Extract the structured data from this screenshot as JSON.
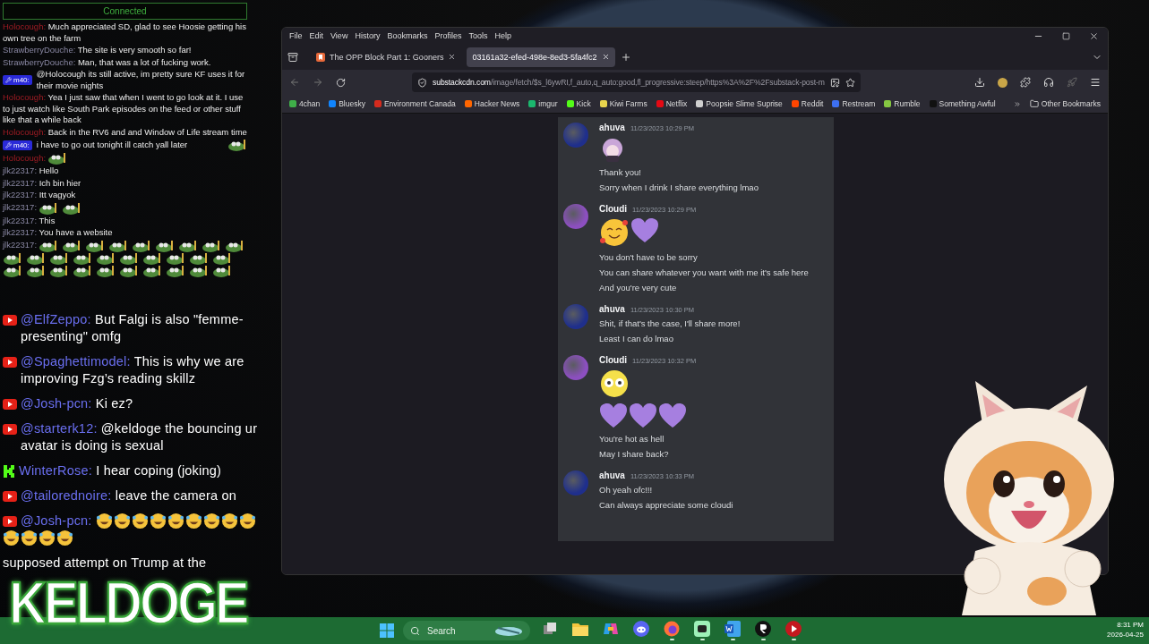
{
  "top_chat": {
    "status": "Connected",
    "messages": [
      {
        "kind": "highlighted",
        "author": "Holocough:",
        "text": "Much appreciated SD, glad to see Hoosie getting his own tree on the farm"
      },
      {
        "kind": "regular",
        "author": "StrawberryDouche:",
        "text": "The site is very smooth so far!"
      },
      {
        "kind": "regular",
        "author": "StrawberryDouche:",
        "text": "Man, that was a lot of fucking work."
      },
      {
        "kind": "moderator",
        "badge": "m40:",
        "text": "@Holocough its still active, im pretty sure KF uses it for their movie nights"
      },
      {
        "kind": "highlighted",
        "author": "Holocough:",
        "text": "Yea I just saw that when I went to go look at it.  I use to just watch like South Park episodes on the feed or other stuff like that a while back"
      },
      {
        "kind": "highlighted",
        "author": "Holocough:",
        "text": "Back in the RV6 and and Window of Life stream time"
      },
      {
        "kind": "moderator",
        "badge": "m40:",
        "text": "i have to go out tonight ill catch yall later",
        "emotes": [
          {
            "kind": "frog"
          }
        ]
      },
      {
        "kind": "highlighted",
        "author": "Holocough:",
        "emotes": [
          {
            "kind": "frog"
          }
        ]
      },
      {
        "kind": "regular",
        "author": "jlk22317:",
        "text": "Hello"
      },
      {
        "kind": "regular",
        "author": "jlk22317:",
        "text": "Ich bin hier"
      },
      {
        "kind": "regular",
        "author": "jlk22317:",
        "text": "Itt vagyok"
      },
      {
        "kind": "regular",
        "author": "jlk22317:",
        "emotes": [
          {
            "kind": "frog"
          },
          {
            "kind": "frog"
          }
        ]
      },
      {
        "kind": "regular",
        "author": "jlk22317:",
        "text": "This"
      },
      {
        "kind": "regular",
        "author": "jlk22317:",
        "text": "You have a website"
      },
      {
        "kind": "regular",
        "author": "jlk22317:",
        "emotes": [
          {
            "kind": "frog"
          },
          {
            "kind": "frog"
          },
          {
            "kind": "frog"
          },
          {
            "kind": "frog"
          },
          {
            "kind": "frog"
          },
          {
            "kind": "frog"
          },
          {
            "kind": "frog"
          },
          {
            "kind": "frog"
          },
          {
            "kind": "frog"
          },
          {
            "kind": "frog"
          },
          {
            "kind": "frog"
          },
          {
            "kind": "frog"
          },
          {
            "kind": "frog"
          },
          {
            "kind": "frog"
          },
          {
            "kind": "frog"
          },
          {
            "kind": "frog"
          },
          {
            "kind": "frog"
          },
          {
            "kind": "frog"
          },
          {
            "kind": "frog"
          },
          {
            "kind": "frog"
          },
          {
            "kind": "frog"
          },
          {
            "kind": "frog"
          },
          {
            "kind": "frog"
          },
          {
            "kind": "frog"
          },
          {
            "kind": "frog"
          },
          {
            "kind": "frog"
          },
          {
            "kind": "frog"
          },
          {
            "kind": "frog"
          },
          {
            "kind": "frog"
          }
        ]
      }
    ]
  },
  "bottom_chat": {
    "messages": [
      {
        "kind": "youtube",
        "author": "@ElfZeppo:",
        "text": "But Falgi is also \"femme-presenting\" omfg"
      },
      {
        "kind": "youtube",
        "author": "@Spaghettimodel:",
        "text": "This is why we are improving Fzg’s reading skillz"
      },
      {
        "kind": "youtube",
        "author": "@Josh-pcn:",
        "text": "Ki ez?"
      },
      {
        "kind": "youtube",
        "author": "@starterk12:",
        "text": "@keldoge the bouncing ur avatar is doing is sexual"
      },
      {
        "kind": "kick",
        "author": "WinterRose:",
        "text": "I hear coping (joking)"
      },
      {
        "kind": "youtube",
        "author": "@tailorednoire:",
        "text": "leave the camera on"
      },
      {
        "kind": "youtube",
        "author": "@Josh-pcn:",
        "emojis": [
          {
            "kind": "rofl"
          },
          {
            "kind": "rofl"
          },
          {
            "kind": "rofl"
          },
          {
            "kind": "rofl"
          },
          {
            "kind": "rofl"
          },
          {
            "kind": "rofl"
          },
          {
            "kind": "rofl"
          },
          {
            "kind": "rofl"
          },
          {
            "kind": "rofl"
          },
          {
            "kind": "rofl"
          },
          {
            "kind": "rofl"
          },
          {
            "kind": "rofl"
          },
          {
            "kind": "rofl"
          }
        ]
      },
      {
        "kind": "plain",
        "text": "supposed attempt on Trump at the"
      }
    ],
    "logo": "KELDOGE"
  },
  "browser": {
    "menu": [
      "File",
      "Edit",
      "View",
      "History",
      "Bookmarks",
      "Profiles",
      "Tools",
      "Help"
    ],
    "tabs": [
      {
        "title": "The OPP Block Part 1: Gooners",
        "selected": false
      },
      {
        "title": "03161a32-efed-498e-8ed3-5fa4fc2",
        "selected": true
      }
    ],
    "address": {
      "domain": "substackcdn.com",
      "path": "/image/fetch/$s_l6ywRI,f_auto,q_auto:good,fl_progressive:steep/https%3A%2F%2Fsubstack-post-m"
    },
    "bookmarks": [
      {
        "label": "4chan",
        "color": "#3fae49"
      },
      {
        "label": "Bluesky",
        "color": "#1185fe"
      },
      {
        "label": "Environment Canada",
        "color": "#d52b1e"
      },
      {
        "label": "Hacker News",
        "color": "#ff6600"
      },
      {
        "label": "imgur",
        "color": "#1bb76e"
      },
      {
        "label": "Kick",
        "color": "#53fc18"
      },
      {
        "label": "Kiwi Farms",
        "color": "#e8d44d"
      },
      {
        "label": "Netflix",
        "color": "#e50914"
      },
      {
        "label": "Poopsie Slime Suprise",
        "color": "#cfcfcf"
      },
      {
        "label": "Reddit",
        "color": "#ff4500"
      },
      {
        "label": "Restream",
        "color": "#3d6ff2"
      },
      {
        "label": "Rumble",
        "color": "#85c742"
      },
      {
        "label": "Something Awful",
        "color": "#111111"
      }
    ],
    "other_bookmarks": "Other Bookmarks",
    "image": {
      "messages": [
        {
          "author": "ahuva",
          "color": "#1f2f8c",
          "time": "11/23/2023 10:29 PM",
          "content": [
            {
              "kind": "emoji",
              "emojis": [
                {
                  "kind": "anime"
                }
              ]
            },
            {
              "kind": "text",
              "text": "Thank you!"
            },
            {
              "kind": "text",
              "text": "Sorry when I drink I share everything lmao"
            }
          ]
        },
        {
          "author": "Cloudi",
          "color": "#8c4fc0",
          "time": "11/23/2023 10:29 PM",
          "content": [
            {
              "kind": "emoji",
              "emojis": [
                {
                  "kind": "blush"
                },
                {
                  "kind": "heart"
                }
              ]
            },
            {
              "kind": "text",
              "text": "You don't have to be sorry"
            },
            {
              "kind": "text",
              "text": "You can share whatever you want with me it's safe here"
            },
            {
              "kind": "text",
              "text": "And you're very cute"
            }
          ]
        },
        {
          "author": "ahuva",
          "color": "#1f2f8c",
          "time": "11/23/2023 10:30 PM",
          "content": [
            {
              "kind": "text",
              "text": "Shit, if that's the case, I'll share more!"
            },
            {
              "kind": "text",
              "text": "Least I can do lmao"
            }
          ]
        },
        {
          "author": "Cloudi",
          "color": "#8c4fc0",
          "time": "11/23/2023 10:32 PM",
          "content": [
            {
              "kind": "emoji",
              "emojis": [
                {
                  "kind": "flushed"
                }
              ]
            },
            {
              "kind": "emoji",
              "emojis": [
                {
                  "kind": "heart"
                },
                {
                  "kind": "heart"
                },
                {
                  "kind": "heart"
                }
              ]
            },
            {
              "kind": "text",
              "text": "You're hot as hell"
            },
            {
              "kind": "text",
              "text": "May I share back?"
            }
          ]
        },
        {
          "author": "ahuva",
          "color": "#1f2f8c",
          "time": "11/23/2023 10:33 PM",
          "content": [
            {
              "kind": "text",
              "text": "Oh yeah ofc!!!"
            },
            {
              "kind": "text",
              "text": "Can always appreciate some cloudi"
            }
          ]
        }
      ]
    }
  },
  "taskbar": {
    "search": "Search",
    "apps": [
      {
        "kind": "task-view",
        "running": false
      },
      {
        "kind": "folder",
        "running": false
      },
      {
        "kind": "copilot",
        "running": false
      },
      {
        "kind": "discord",
        "running": false
      },
      {
        "kind": "firefox",
        "running": true
      },
      {
        "kind": "chat",
        "running": true
      },
      {
        "kind": "word",
        "running": true
      },
      {
        "kind": "r-app",
        "running": true
      },
      {
        "kind": "player",
        "running": true
      }
    ],
    "time": "8:31 PM",
    "date": "2026-04-25"
  }
}
